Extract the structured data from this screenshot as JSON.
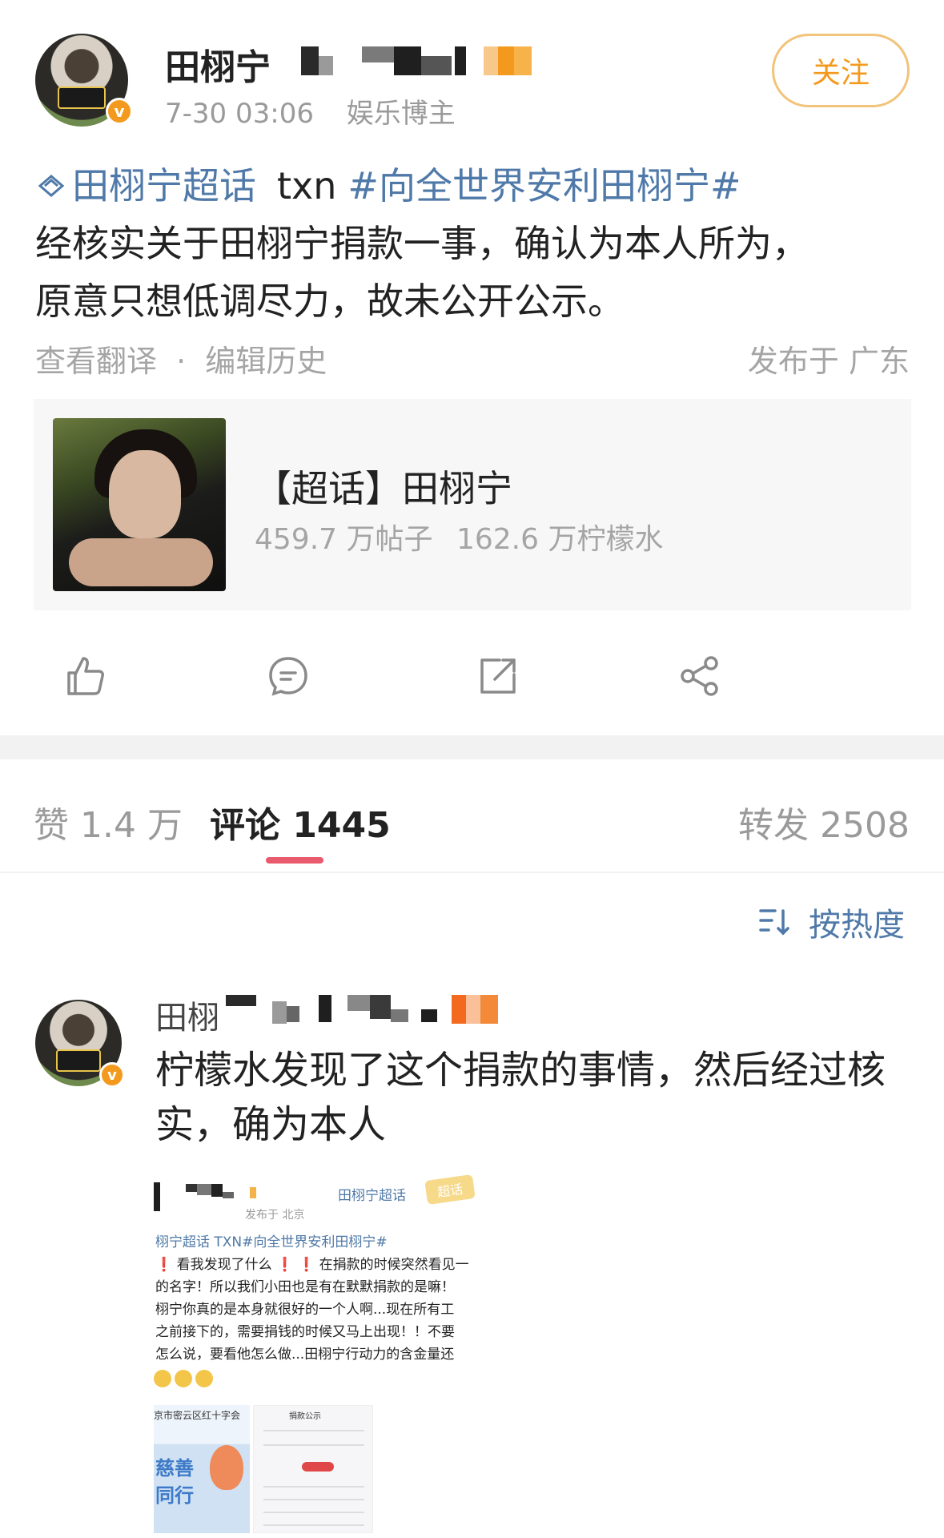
{
  "post": {
    "author": "田栩宁",
    "time": "7-30 03:06",
    "role": "娱乐博主",
    "follow_label": "关注",
    "badge_letter": "v",
    "topic_link": "田栩宁超话",
    "tag_plain": "txn",
    "hashtag": "#向全世界安利田栩宁#",
    "body_line1": "经核实关于田栩宁捐款一事，确认为本人所为，",
    "body_line2": "原意只想低调尽力，故未公开公示。",
    "translate_label": "查看翻译",
    "separator": "·",
    "edit_history_label": "编辑历史",
    "location": "发布于 广东"
  },
  "topic_card": {
    "title": "【超话】田栩宁",
    "posts": "459.7 万帖子",
    "fans": "162.6 万柠檬水"
  },
  "actions": {
    "like_icon": "thumb-up-icon",
    "comment_icon": "comment-icon",
    "repost_icon": "repost-icon",
    "share_icon": "share-icon"
  },
  "tabs": {
    "likes": "赞 1.4 万",
    "comments": "评论 1445",
    "reposts": "转发 2508",
    "active_color": "#ea5a6d"
  },
  "sort": {
    "label": "按热度",
    "icon": "sort-icon"
  },
  "comment": {
    "author": "田栩",
    "text": "柠檬水发现了这个捐款的事情，然后经过核实，确为本人"
  },
  "embedded_screenshot": {
    "meta": "发布于 北京",
    "topic": "田栩宁超话",
    "badge": "超话",
    "line1_link": "栩宁超话 TXN#向全世界安利田栩宁#",
    "line2_mark1": "❗",
    "line2_text": " 看我发现了什么 ",
    "line2_mark2": "❗ ❗",
    "line2_tail": " 在捐款的时候突然看见一",
    "line3": "的名字！所以我们小田也是有在默默捐款的是嘛！",
    "line4": "栩宁你真的是本身就很好的一个人啊...现在所有工",
    "line5": "之前接下的，需要捐钱的时候又马上出现！！不要",
    "line6": "怎么说，要看他怎么做...田栩宁行动力的含金量还",
    "card1_title": "京市密云区红十字会",
    "card1_slogan": "慈善\n同行",
    "card2_title": "捐款公示"
  },
  "colors": {
    "link": "#4f79a8",
    "follow": "#f39a1e",
    "follow_border": "#f2c37a",
    "verified": "#f39a1e",
    "muted": "#9a9a9a"
  }
}
